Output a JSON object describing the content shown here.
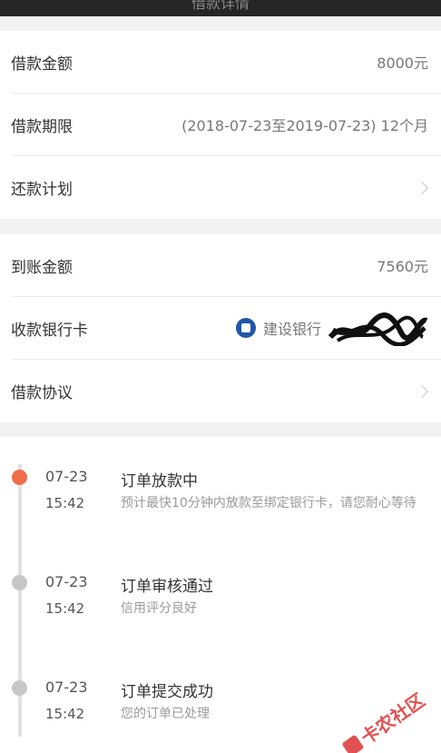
{
  "header": {
    "title": "借款详情"
  },
  "loan": {
    "amount_label": "借款金额",
    "amount_value": "8000元",
    "term_label": "借款期限",
    "term_value": "(2018-07-23至2019-07-23) 12个月",
    "plan_label": "还款计划"
  },
  "payout": {
    "received_label": "到账金额",
    "received_value": "7560元",
    "bank_label": "收款银行卡",
    "bank_name": "建设银行",
    "agreement_label": "借款协议"
  },
  "timeline": [
    {
      "date": "07-23",
      "time": "15:42",
      "title": "订单放款中",
      "desc": "预计最快10分钟内放款至绑定银行卡，请您耐心等待",
      "active": true
    },
    {
      "date": "07-23",
      "time": "15:42",
      "title": "订单审核通过",
      "desc": "信用评分良好",
      "active": false
    },
    {
      "date": "07-23",
      "time": "15:42",
      "title": "订单提交成功",
      "desc": "您的订单已处理",
      "active": false
    }
  ],
  "watermark": {
    "text": "卡农社区"
  },
  "colors": {
    "accent": "#f06d4a",
    "bank_blue": "#1f57a8",
    "watermark": "#dd3333"
  }
}
